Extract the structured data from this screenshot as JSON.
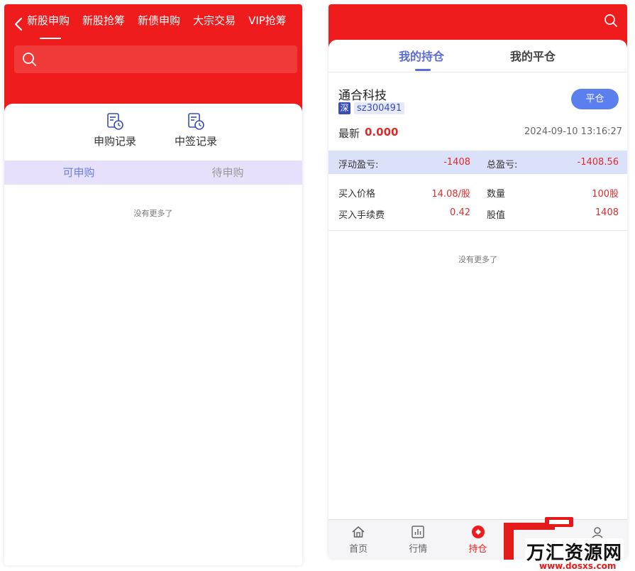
{
  "left": {
    "top_tabs": [
      "新股申购",
      "新股抢筹",
      "新债申购",
      "大宗交易",
      "VIP抢筹"
    ],
    "search": {
      "placeholder": ""
    },
    "records": {
      "apply": "申购记录",
      "win": "中签记录"
    },
    "sub_tabs": {
      "active": "可申购",
      "inactive": "待申购"
    },
    "no_more": "没有更多了"
  },
  "right": {
    "tabs": {
      "active": "我的持仓",
      "inactive": "我的平仓"
    },
    "position": {
      "name": "通合科技",
      "exchange": "深",
      "code": "sz300491",
      "close_label": "平仓",
      "latest_label": "最新",
      "latest_value": "0.000",
      "time": "2024-09-10 13:16:27",
      "float_pl_label": "浮动盈亏:",
      "float_pl_value": "-1408",
      "total_pl_label": "总盈亏:",
      "total_pl_value": "-1408.56",
      "buy_price_label": "买入价格",
      "buy_price_value": "14.08/股",
      "qty_label": "数量",
      "qty_value": "100股",
      "fee_label": "买入手续费",
      "fee_value": "0.42",
      "mv_label": "股值",
      "mv_value": "1408"
    },
    "no_more": "没有更多了",
    "nav": {
      "home": "首页",
      "market": "行情",
      "position": "持仓"
    }
  },
  "watermark": {
    "name": "万汇资源网",
    "url": "www.dosxs.com"
  },
  "colors": {
    "brand_red": "#ee1c1c",
    "accent_blue": "#5b6cd8",
    "loss_red": "#e02b2b"
  }
}
